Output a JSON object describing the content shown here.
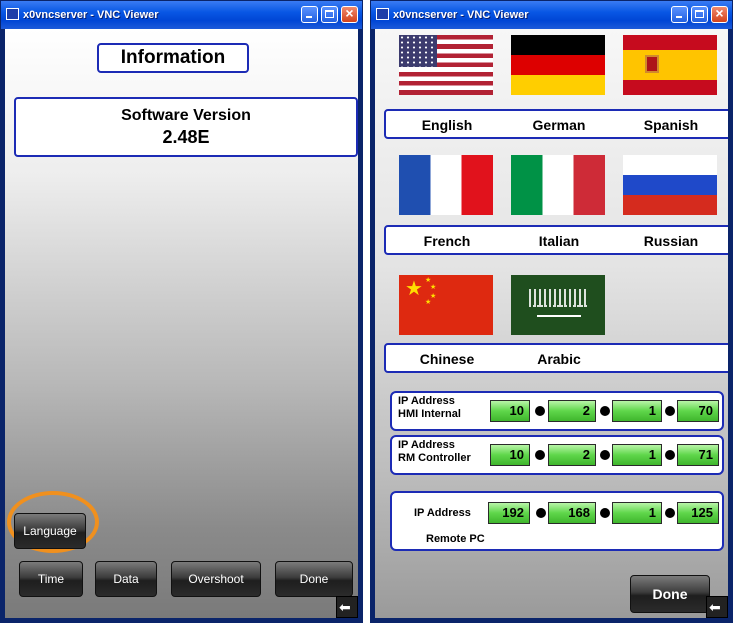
{
  "window_left": {
    "title": "x0vncserver - VNC Viewer",
    "header": "Information",
    "software_version_label": "Software Version",
    "software_version_value": "2.48E",
    "buttons": {
      "language": "Language",
      "time": "Time",
      "data": "Data",
      "overshoot": "Overshoot",
      "done": "Done"
    },
    "highlight_color": "#f0901e"
  },
  "window_right": {
    "title": "x0vncserver - VNC Viewer",
    "languages": [
      "English",
      "German",
      "Spanish",
      "French",
      "Italian",
      "Russian",
      "Chinese",
      "Arabic"
    ],
    "flags": [
      "us-flag-icon",
      "germany-flag-icon",
      "spain-flag-icon",
      "france-flag-icon",
      "italy-flag-icon",
      "russia-flag-icon",
      "china-flag-icon",
      "saudi-arabia-flag-icon"
    ],
    "ip_sections": [
      {
        "label_line1": "IP Address",
        "label_line2": "HMI Internal",
        "octets": [
          "10",
          "2",
          "1",
          "70"
        ]
      },
      {
        "label_line1": "IP Address",
        "label_line2": "RM Controller",
        "octets": [
          "10",
          "2",
          "1",
          "71"
        ]
      },
      {
        "label_line1": "IP Address",
        "label_line2": "Remote PC",
        "octets": [
          "192",
          "168",
          "1",
          "125"
        ]
      }
    ],
    "done": "Done"
  },
  "colors": {
    "titlebar": "#0857e4",
    "panel_border": "#1c2bb5",
    "ip_field": "#5fd64a"
  },
  "titlebar_icon_text": "VC"
}
